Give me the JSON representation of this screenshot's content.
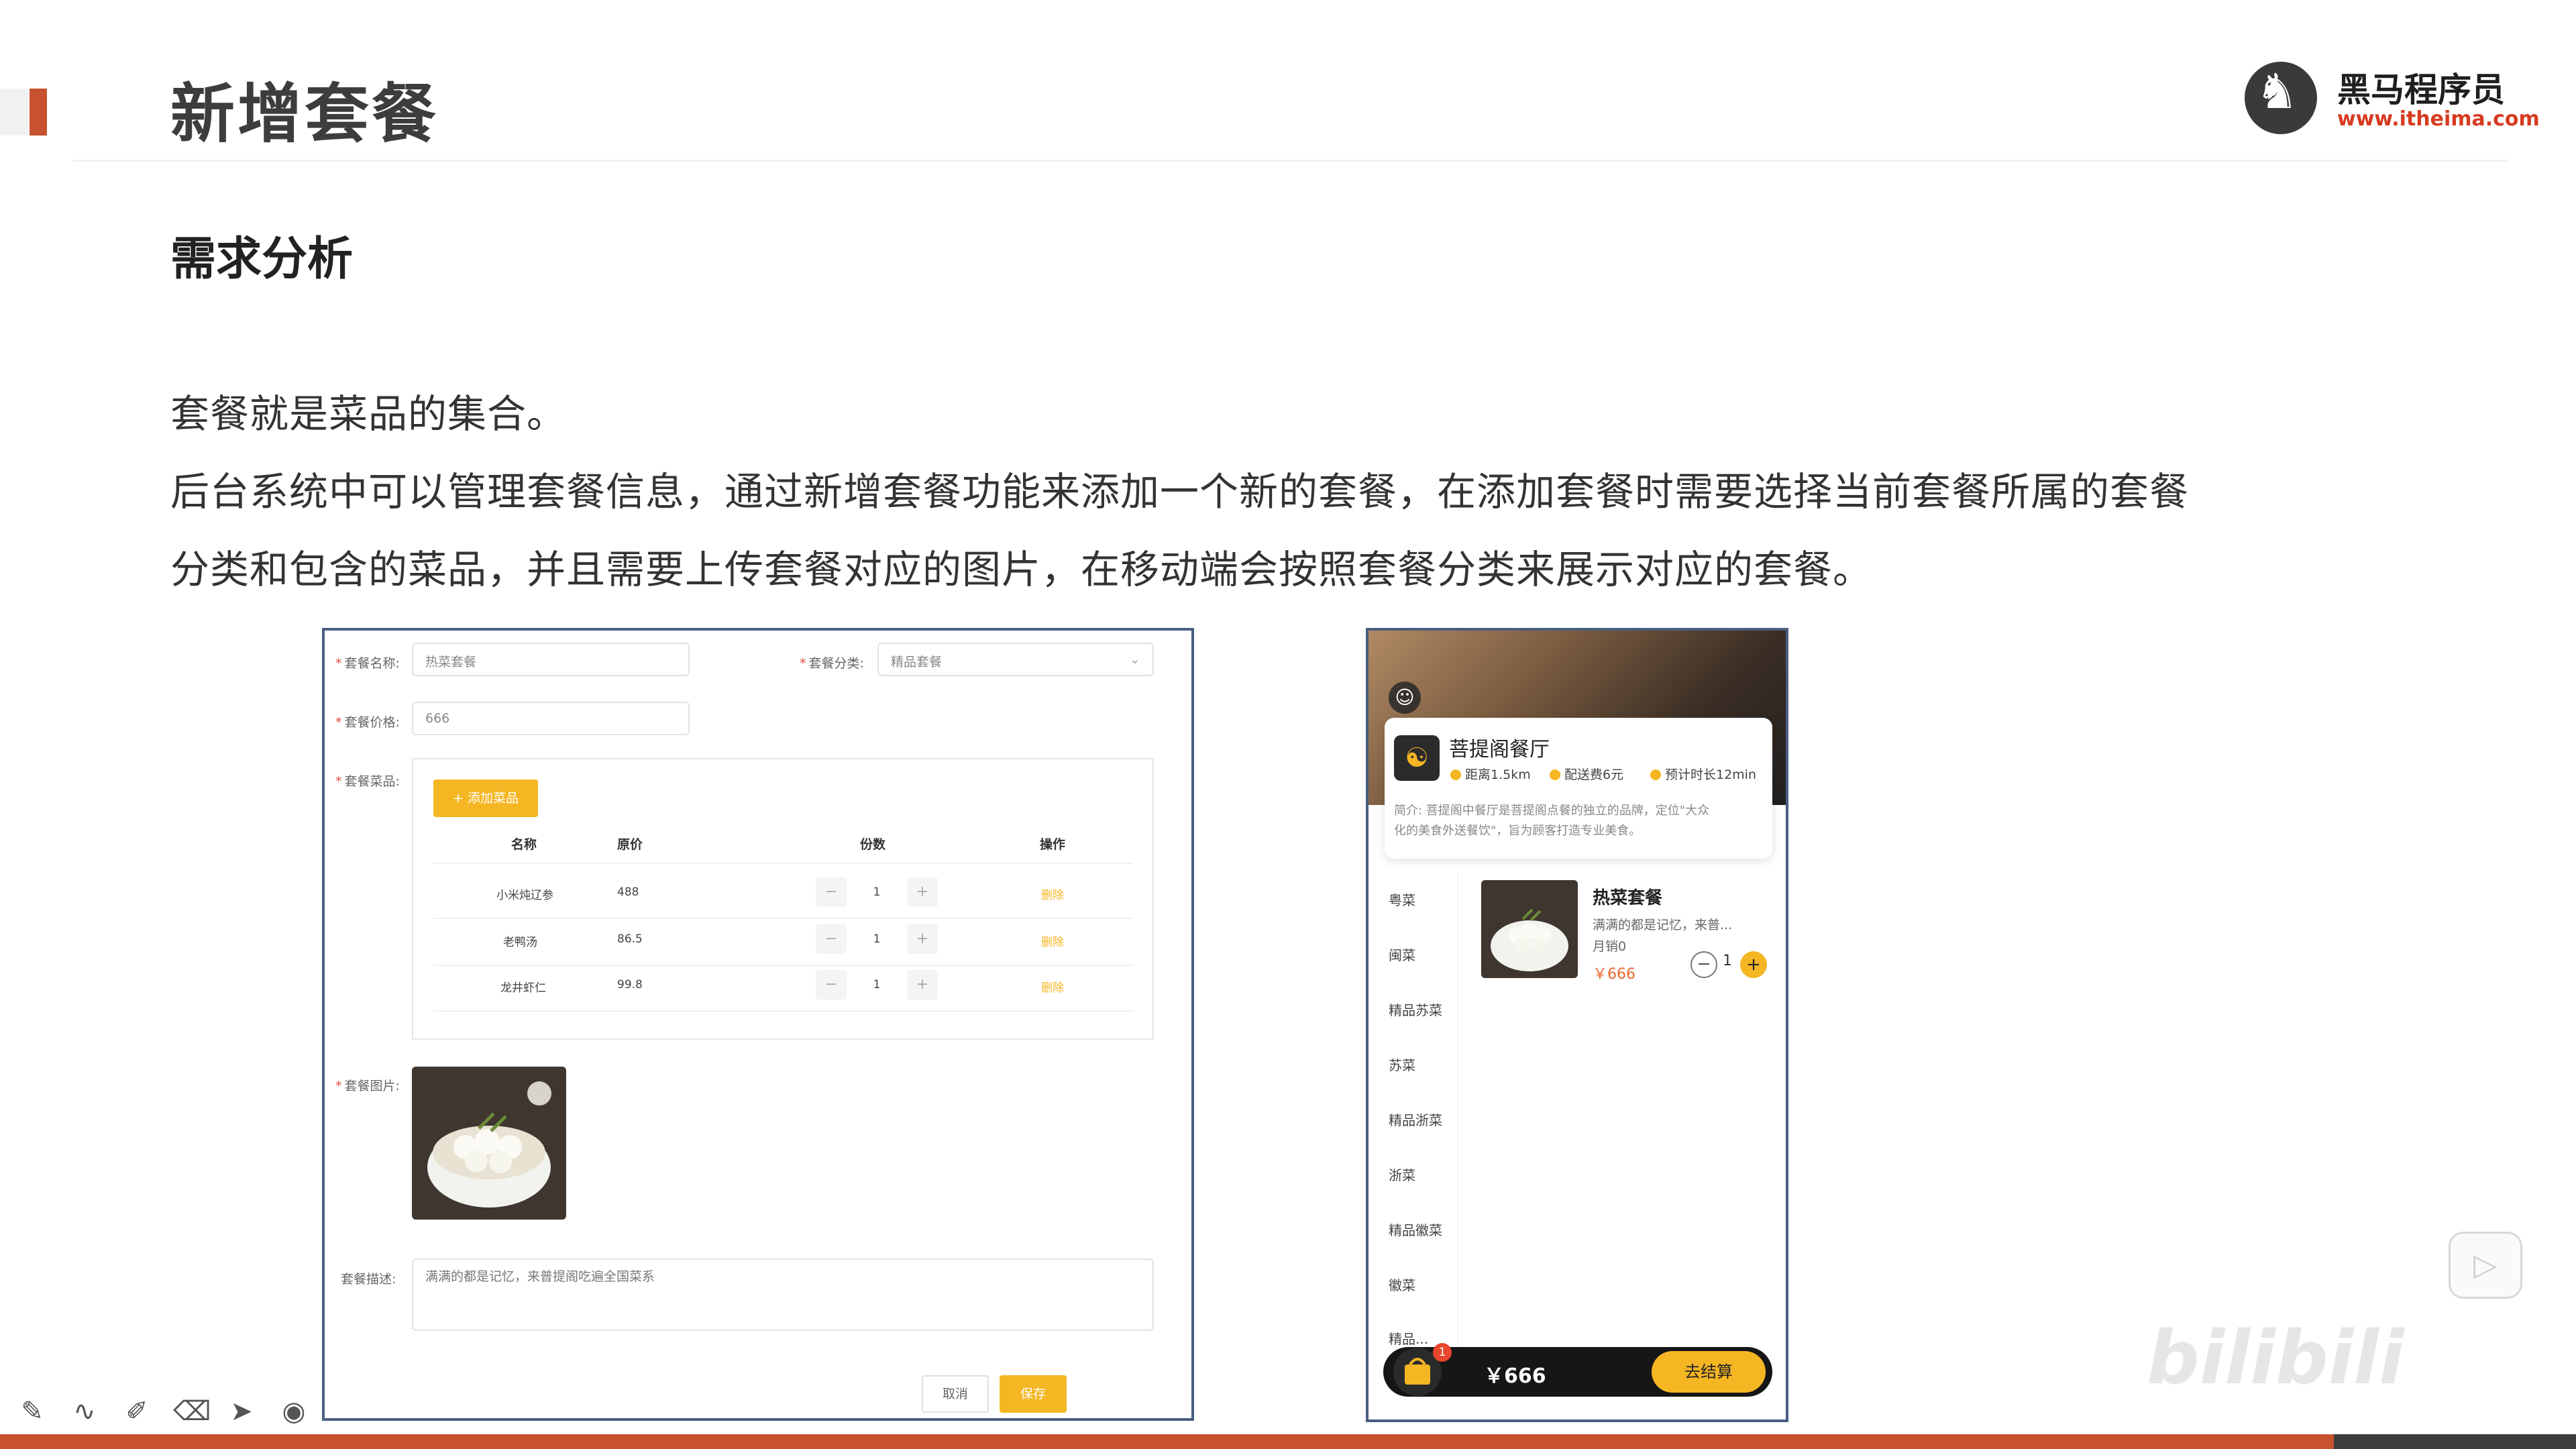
{
  "slide": {
    "title": "新增套餐",
    "section_title": "需求分析",
    "paragraphs": [
      "套餐就是菜品的集合。",
      "后台系统中可以管理套餐信息，通过新增套餐功能来添加一个新的套餐，在添加套餐时需要选择当前套餐所属的套餐",
      "分类和包含的菜品，并且需要上传套餐对应的图片，在移动端会按照套餐分类来展示对应的套餐。"
    ]
  },
  "logo": {
    "name": "黑马程序员",
    "url": "www.itheima.com"
  },
  "admin_form": {
    "name_label": "套餐名称:",
    "name_value": "热菜套餐",
    "category_label": "套餐分类:",
    "category_value": "精品套餐",
    "price_label": "套餐价格:",
    "price_value": "666",
    "dishes_label": "套餐菜品:",
    "add_dish_button": "+ 添加菜品",
    "table_headers": [
      "名称",
      "原价",
      "份数",
      "操作"
    ],
    "rows": [
      {
        "name": "小米炖辽参",
        "price": "488",
        "qty": "1",
        "action": "删除"
      },
      {
        "name": "老鸭汤",
        "price": "86.5",
        "qty": "1",
        "action": "删除"
      },
      {
        "name": "龙井虾仁",
        "price": "99.8",
        "qty": "1",
        "action": "删除"
      }
    ],
    "image_label": "套餐图片:",
    "desc_label": "套餐描述:",
    "desc_value": "满满的都是记忆，来普提阁吃遍全国菜系",
    "cancel_button": "取消",
    "save_button": "保存"
  },
  "mobile": {
    "shop_name": "菩提阁餐厅",
    "distance": "距离1.5km",
    "delivery_fee": "配送费6元",
    "eta": "预计时长12min",
    "intro": "简介: 菩提阁中餐厅是菩提阁点餐的独立的品牌，定位\"大众\n化的美食外送餐饮\"，旨为顾客打造专业美食。",
    "categories": [
      "粤菜",
      "闽菜",
      "精品苏菜",
      "苏菜",
      "精品浙菜",
      "浙菜",
      "精品徽菜",
      "徽菜",
      "精品..."
    ],
    "dish": {
      "name": "热菜套餐",
      "desc": "满满的都是记忆，来普...",
      "sales": "月销0",
      "price": "￥666",
      "qty": "1"
    },
    "cart_badge": "1",
    "cart_total": "￥666",
    "checkout_button": "去结算"
  },
  "player": {
    "watermark": "bilibili",
    "progress": 0.906
  },
  "icons": {
    "pen": "pen-icon",
    "curve": "curve-icon",
    "highlighter": "highlighter-icon",
    "eraser": "eraser-icon",
    "pointer": "pointer-icon",
    "record": "record-icon",
    "play": "play-icon"
  },
  "colors": {
    "accent": "#c8512f",
    "button_yellow": "#f5b623",
    "frame_border": "#4a5e80",
    "price_orange": "#e8662b"
  }
}
